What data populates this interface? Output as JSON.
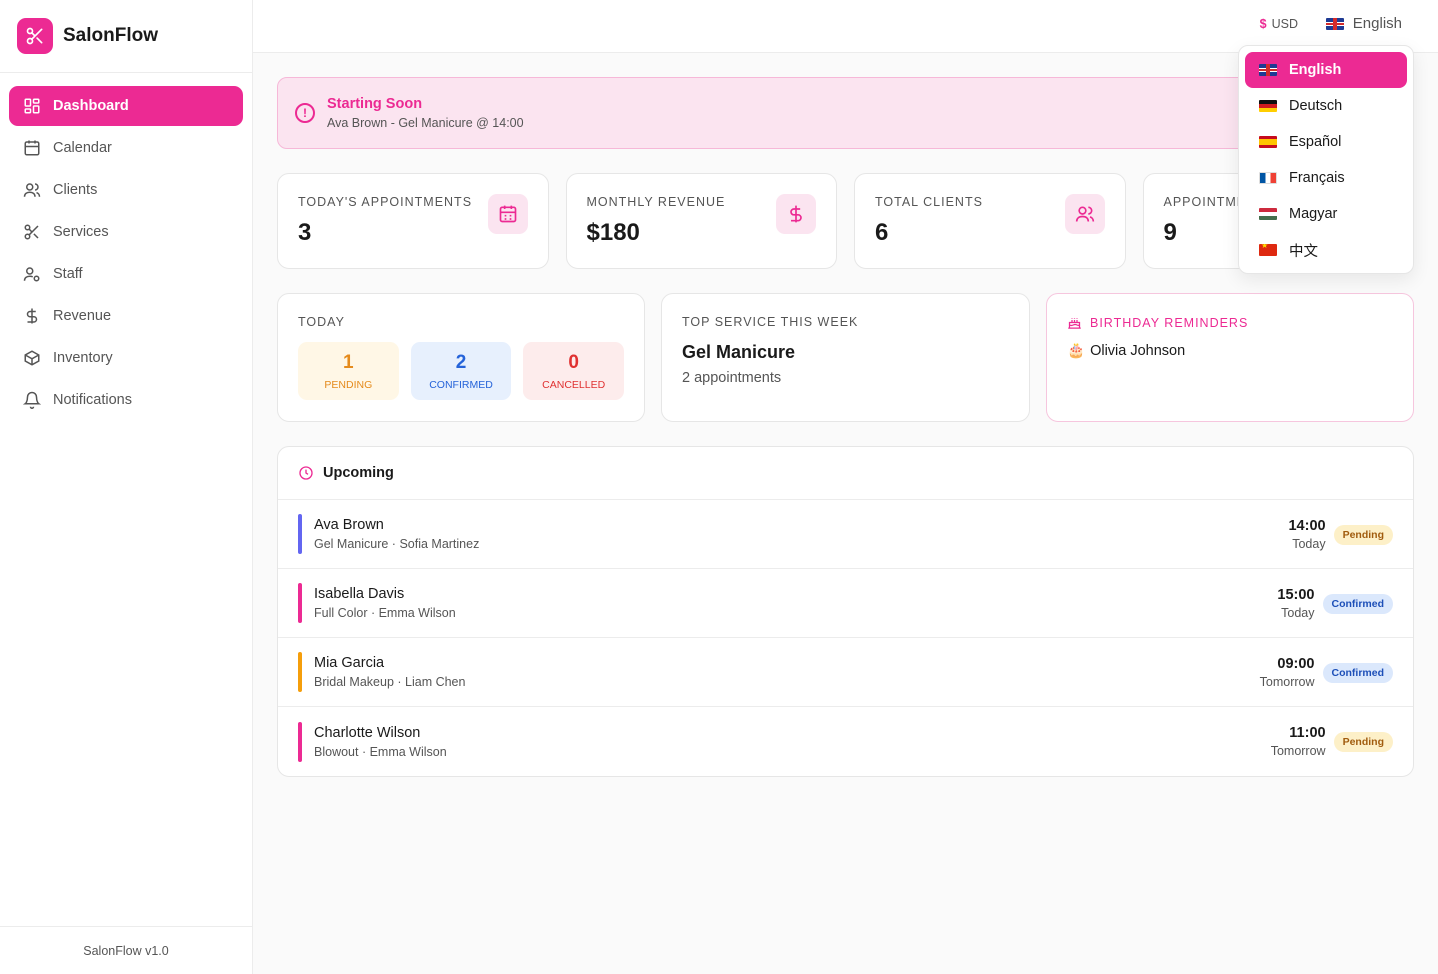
{
  "brand": {
    "name": "SalonFlow",
    "version": "SalonFlow v1.0",
    "accent": "#ec2a93"
  },
  "nav": [
    {
      "label": "Dashboard",
      "icon": "dashboard-icon",
      "active": true
    },
    {
      "label": "Calendar",
      "icon": "calendar-icon"
    },
    {
      "label": "Clients",
      "icon": "users-icon"
    },
    {
      "label": "Services",
      "icon": "scissors-icon"
    },
    {
      "label": "Staff",
      "icon": "staff-icon"
    },
    {
      "label": "Revenue",
      "icon": "dollar-icon"
    },
    {
      "label": "Inventory",
      "icon": "box-icon"
    },
    {
      "label": "Notifications",
      "icon": "bell-icon"
    }
  ],
  "topbar": {
    "currency_symbol": "$",
    "currency": "USD",
    "language": "English"
  },
  "alert": {
    "title": "Starting Soon",
    "message": "Ava Brown - Gel Manicure @ 14:00"
  },
  "stats": [
    {
      "label": "TODAY'S APPOINTMENTS",
      "value": "3",
      "icon": "calendar-icon"
    },
    {
      "label": "MONTHLY REVENUE",
      "value": "$180",
      "icon": "dollar-icon"
    },
    {
      "label": "TOTAL CLIENTS",
      "value": "6",
      "icon": "users-icon"
    },
    {
      "label": "APPOINTME",
      "value": "9",
      "icon": "none"
    }
  ],
  "today": {
    "label": "TODAY",
    "pending": {
      "count": "1",
      "label": "PENDING"
    },
    "confirmed": {
      "count": "2",
      "label": "CONFIRMED"
    },
    "cancelled": {
      "count": "0",
      "label": "CANCELLED"
    }
  },
  "top_service": {
    "label": "TOP SERVICE THIS WEEK",
    "name": "Gel Manicure",
    "count": "2 appointments"
  },
  "birthdays": {
    "label": "BIRTHDAY REMINDERS",
    "emoji": "🎂",
    "name": "Olivia Johnson"
  },
  "upcoming": {
    "title": "Upcoming",
    "rows": [
      {
        "name": "Ava Brown",
        "sub": "Gel Manicure · Sofia Martinez",
        "time": "14:00",
        "day": "Today",
        "status": "Pending",
        "color": "#6366f1"
      },
      {
        "name": "Isabella Davis",
        "sub": "Full Color · Emma Wilson",
        "time": "15:00",
        "day": "Today",
        "status": "Confirmed",
        "color": "#ec2a93"
      },
      {
        "name": "Mia Garcia",
        "sub": "Bridal Makeup · Liam Chen",
        "time": "09:00",
        "day": "Tomorrow",
        "status": "Confirmed",
        "color": "#f59e0b"
      },
      {
        "name": "Charlotte Wilson",
        "sub": "Blowout · Emma Wilson",
        "time": "11:00",
        "day": "Tomorrow",
        "status": "Pending",
        "color": "#ec2a93"
      }
    ]
  },
  "languages": [
    {
      "label": "English",
      "flag": "gb",
      "active": true
    },
    {
      "label": "Deutsch",
      "flag": "de"
    },
    {
      "label": "Español",
      "flag": "es"
    },
    {
      "label": "Français",
      "flag": "fr"
    },
    {
      "label": "Magyar",
      "flag": "hu"
    },
    {
      "label": "中文",
      "flag": "cn"
    }
  ]
}
